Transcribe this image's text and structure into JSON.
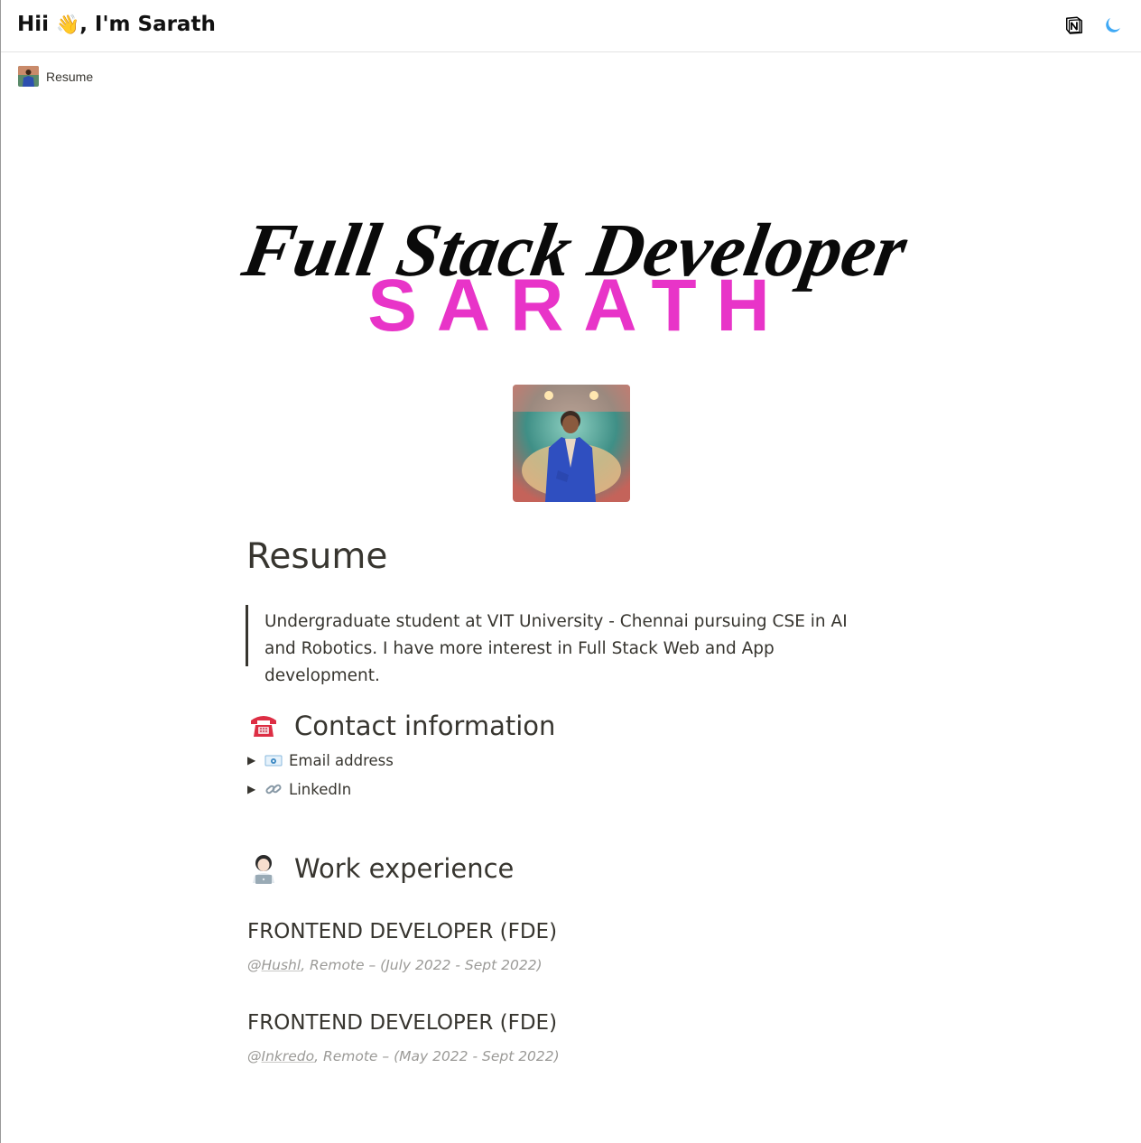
{
  "header": {
    "title_prefix": "Hii ",
    "wave_emoji": "👋",
    "title_suffix": ", I'm Sarath",
    "notion_icon": "notion-logo-icon",
    "theme_icon": "moon-icon"
  },
  "breadcrumb": {
    "label": "Resume",
    "avatar_icon": "profile-photo-thumbnail"
  },
  "cover": {
    "script_text": "Full Stack Developer",
    "name_text": "SARATH",
    "accent_color": "#e834c8"
  },
  "page": {
    "title": "Resume",
    "quote": "Undergraduate student at VIT University - Chennai pursuing CSE in AI and Robotics. I have more interest in Full Stack Web and App development."
  },
  "contact": {
    "heading": "Contact information",
    "emoji": "telephone-icon",
    "items": [
      {
        "label": "Email address",
        "icon": "envelope-icon"
      },
      {
        "label": "LinkedIn",
        "icon": "link-icon"
      }
    ]
  },
  "work": {
    "heading": "Work experience",
    "emoji": "technologist-icon",
    "jobs": [
      {
        "role": "FRONTEND DEVELOPER (FDE)",
        "at": "@",
        "company": "Hushl",
        "details": ", Remote – (July 2022 - Sept 2022)"
      },
      {
        "role": "FRONTEND DEVELOPER (FDE)",
        "at": "@",
        "company": "Inkredo",
        "details": ", Remote – (May 2022 - Sept 2022)"
      }
    ]
  }
}
